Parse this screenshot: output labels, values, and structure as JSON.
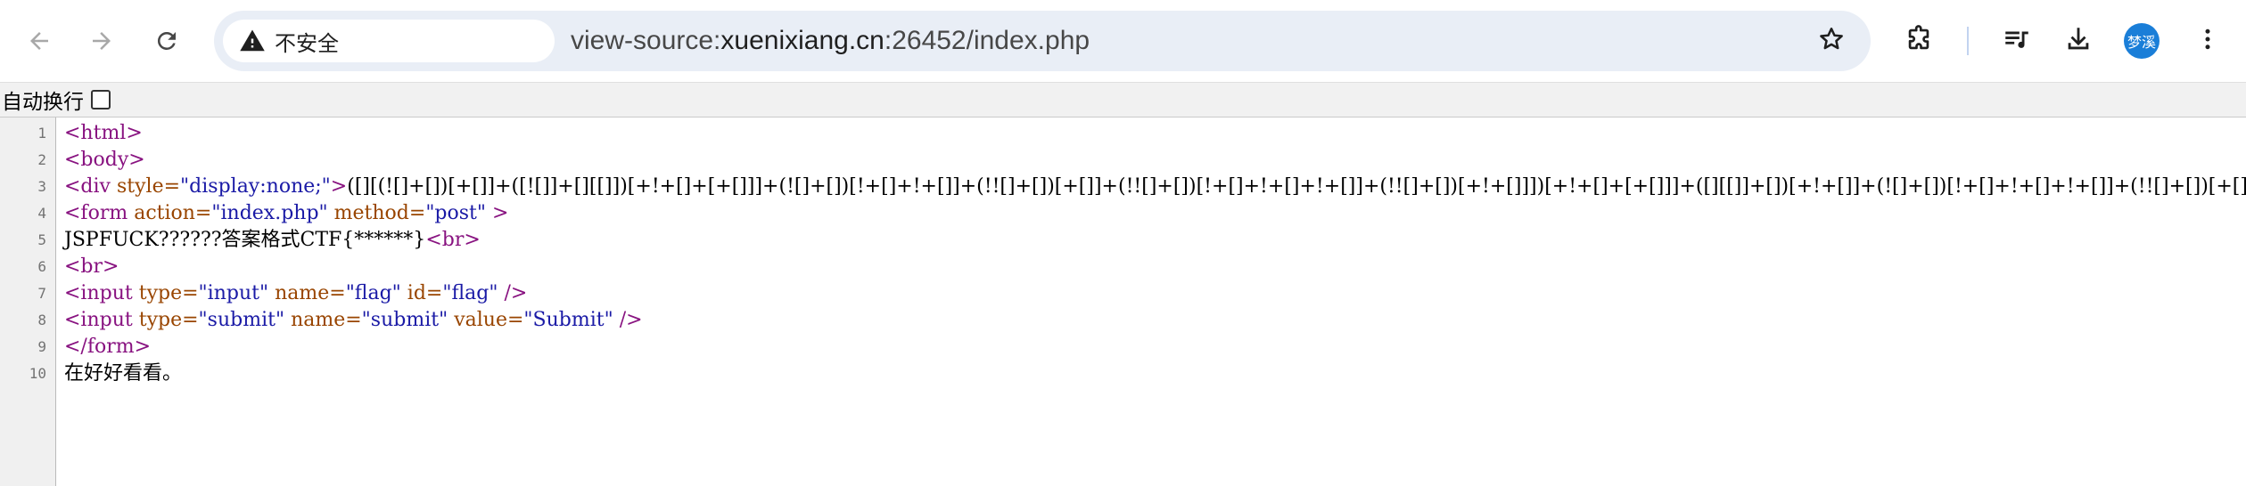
{
  "browser": {
    "security_label": "不安全",
    "url_scheme": "view-source:",
    "url_host": "xuenixiang.cn",
    "url_rest": ":26452/index.php",
    "avatar_text": "梦溪",
    "icons": {
      "back": "arrow-left-icon",
      "forward": "arrow-right-icon",
      "reload": "reload-icon",
      "warning": "warning-triangle-icon",
      "bookmark": "star-icon",
      "extensions": "puzzle-icon",
      "media": "media-queue-icon",
      "downloads": "download-icon",
      "menu": "kebab-menu-icon"
    },
    "colors": {
      "omnibox_bg": "#e9eef6",
      "avatar_bg": "#1a7ed8"
    }
  },
  "wrapbar": {
    "label": "自动换行",
    "checked": false
  },
  "source": {
    "colors": {
      "tag": "#881280",
      "attribute": "#994500",
      "value": "#1a1aa6",
      "gutter_bg": "#f0f0f0"
    },
    "lines": [
      {
        "number": "1",
        "tag": "<html>"
      },
      {
        "number": "2",
        "tag": "<body>"
      },
      {
        "number": "3",
        "tag_open": "<div ",
        "attr": "style=",
        "value": "\"display:none;\"",
        "tag_close": ">",
        "text": "([][(![]+[])[+[]]+([![]]+[][[]])[+!+[]+[+[]]]+(![]+[])[!+[]+!+[]]+(!![]+[])[+[]]+(!![]+[])[!+[]+!+[]+!+[]]+(!![]+[])[+!+[]]])[+!+[]+[+[]]]+([][[]]+[])[+!+[]]+(![]+[])[!+[]+!+[]+!+[]]+(!![]+[])[+[]]+(!![]+[])[+!+[]]+([][[]]+[])[+[]]+([][(![]+[])[+[]]+([![]]+[][[]])[+!+[]+[+[]]]"
      },
      {
        "number": "4",
        "tag_open": "<form ",
        "attr1": "action=",
        "value1": "\"index.php\"",
        "attr2": " method=",
        "value2": "\"post\"",
        "tag_close": " >"
      },
      {
        "number": "5",
        "text": "JSPFUCK??????答案格式CTF{******}",
        "tag": "<br>"
      },
      {
        "number": "6",
        "tag": "<br>"
      },
      {
        "number": "7",
        "tag_open": "<input ",
        "attr1": "type=",
        "value1": "\"input\"",
        "attr2": " name=",
        "value2": "\"flag\"",
        "attr3": " id=",
        "value3": "\"flag\"",
        "tag_close": " />"
      },
      {
        "number": "8",
        "tag_open": "<input ",
        "attr1": "type=",
        "value1": "\"submit\"",
        "attr2": " name=",
        "value2": "\"submit\"",
        "attr3": " value=",
        "value3": "\"Submit\"",
        "tag_close": " />"
      },
      {
        "number": "9",
        "tag": "</form>"
      },
      {
        "number": "10",
        "text": "在好好看看。"
      }
    ]
  }
}
